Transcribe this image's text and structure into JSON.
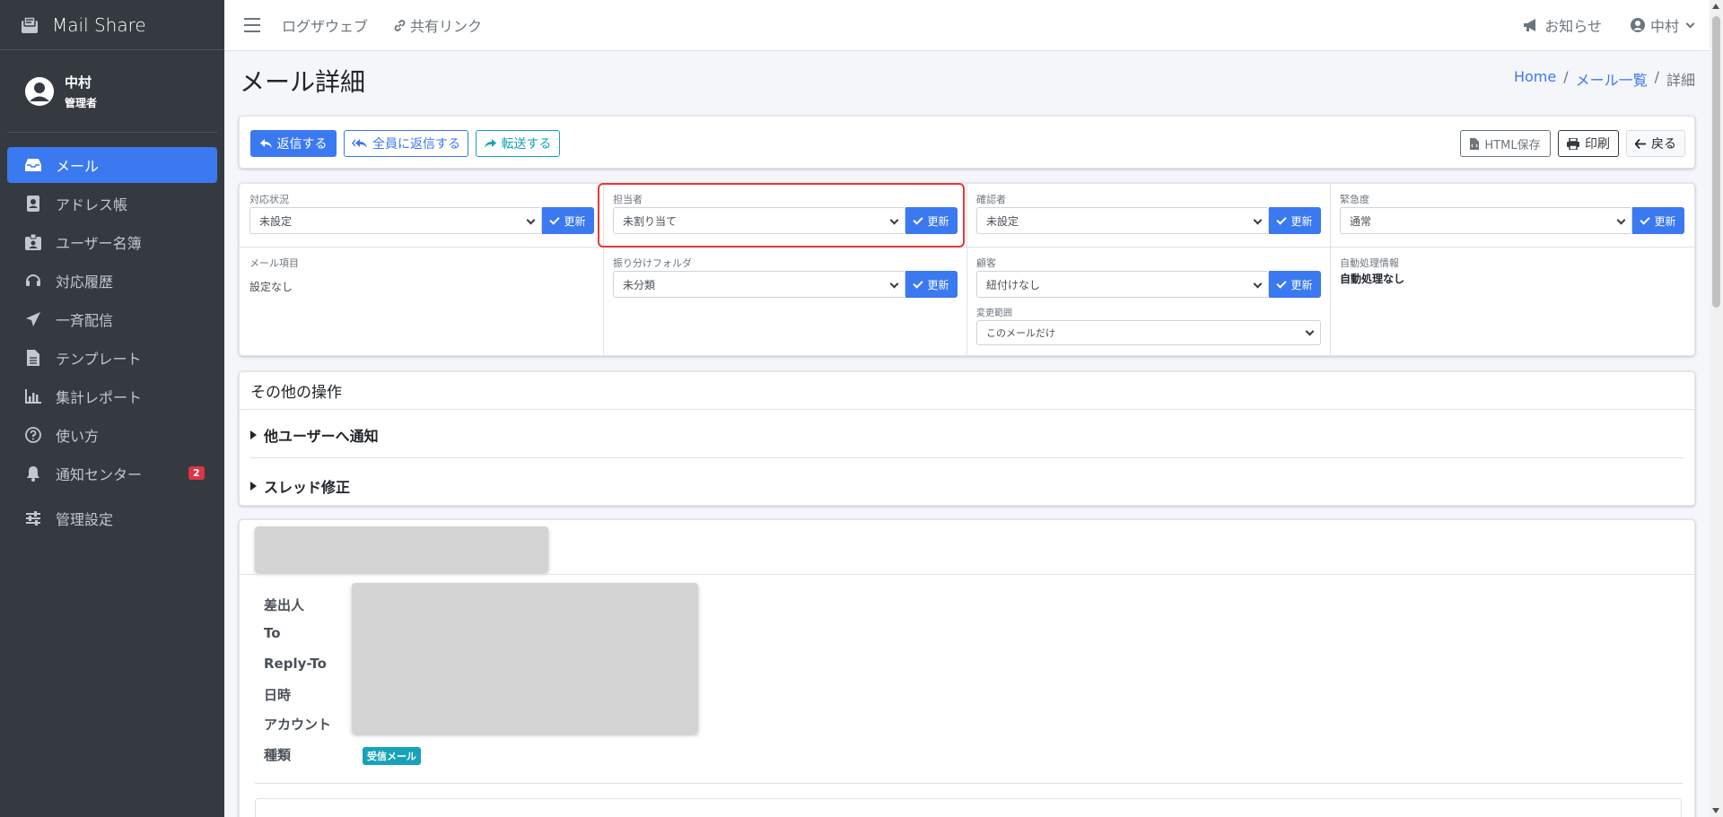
{
  "brand": {
    "title": "Mail Share"
  },
  "user": {
    "name": "中村",
    "role": "管理者"
  },
  "sidebar": {
    "items": [
      {
        "label": "メール",
        "icon": "inbox-icon",
        "active": true
      },
      {
        "label": "アドレス帳",
        "icon": "address-book-icon"
      },
      {
        "label": "ユーザー名簿",
        "icon": "id-badge-icon"
      },
      {
        "label": "対応履歴",
        "icon": "headset-icon"
      },
      {
        "label": "一斉配信",
        "icon": "paper-plane-icon"
      },
      {
        "label": "テンプレート",
        "icon": "file-icon"
      },
      {
        "label": "集計レポート",
        "icon": "chart-icon"
      },
      {
        "label": "使い方",
        "icon": "question-circle-icon"
      },
      {
        "label": "通知センター",
        "icon": "bell-icon",
        "badge": "2"
      },
      {
        "label": "管理設定",
        "icon": "sliders-icon"
      }
    ]
  },
  "topbar": {
    "link1": "ログザウェブ",
    "link2": "共有リンク",
    "notice": "お知らせ",
    "user": "中村"
  },
  "page": {
    "title": "メール詳細",
    "breadcrumb": {
      "home": "Home",
      "list": "メール一覧",
      "current": "詳細",
      "sep": "/"
    }
  },
  "actions": {
    "reply": "返信する",
    "reply_all": "全員に返信する",
    "forward": "転送する",
    "html_save": "HTML保存",
    "print": "印刷",
    "back": "戻る"
  },
  "settings": {
    "update_label": "更新",
    "status": {
      "label": "対応状況",
      "value": "未設定"
    },
    "assignee": {
      "label": "担当者",
      "value": "未割り当て"
    },
    "confirmer": {
      "label": "確認者",
      "value": "未設定"
    },
    "urgency": {
      "label": "緊急度",
      "value": "通常"
    },
    "mail_item": {
      "label": "メール項目",
      "value": "設定なし"
    },
    "folder": {
      "label": "振り分けフォルダ",
      "value": "未分類"
    },
    "customer": {
      "label": "顧客",
      "value": "紐付けなし"
    },
    "scope": {
      "label": "変更範囲",
      "value": "このメールだけ"
    },
    "auto": {
      "label": "自動処理情報",
      "value": "自動処理なし"
    }
  },
  "ops": {
    "title": "その他の操作",
    "notify": "他ユーザーへ通知",
    "thread": "スレッド修正"
  },
  "detail": {
    "from_label": "差出人",
    "to_label": "To",
    "reply_to_label": "Reply-To",
    "date_label": "日時",
    "account_label": "アカウント",
    "type_label": "種類",
    "type_badge": "受信メール"
  },
  "colors": {
    "primary": "#3b79f0",
    "sidebar": "#343a40",
    "info": "#17a2b8",
    "danger": "#dc3545",
    "highlight": "#e53935"
  }
}
